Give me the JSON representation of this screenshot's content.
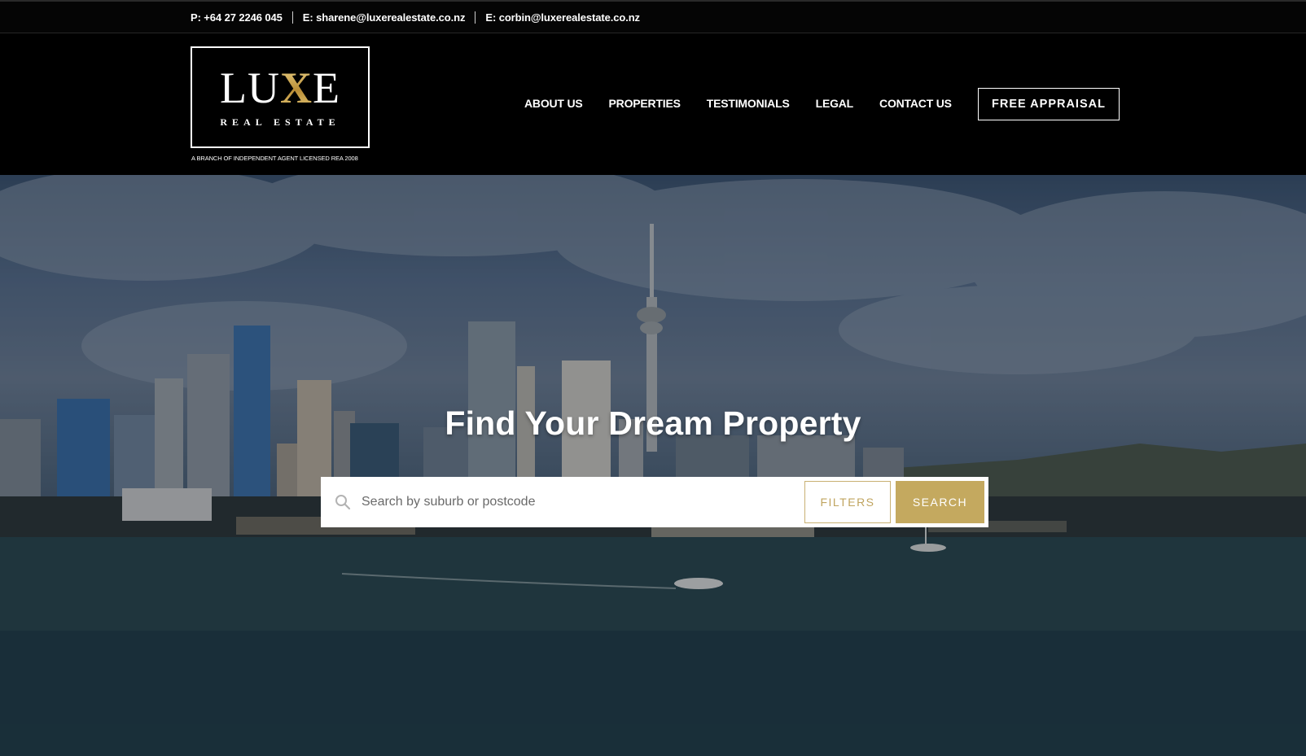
{
  "topbar": {
    "phone": "P: +64 27 2246 045",
    "email1": "E: sharene@luxerealestate.co.nz",
    "email2": "E: corbin@luxerealestate.co.nz"
  },
  "logo": {
    "word_start": "LU",
    "word_x": "X",
    "word_end": "E",
    "subtitle": "REAL ESTATE",
    "caption": "A BRANCH OF INDEPENDENT AGENT LICENSED REA 2008"
  },
  "nav": {
    "items": [
      {
        "label": "ABOUT US"
      },
      {
        "label": "PROPERTIES"
      },
      {
        "label": "TESTIMONIALS"
      },
      {
        "label": "LEGAL"
      },
      {
        "label": "CONTACT US"
      }
    ],
    "cta": "FREE APPRAISAL"
  },
  "hero": {
    "title": "Find Your Dream Property"
  },
  "search": {
    "placeholder": "Search by suburb or postcode",
    "value": "",
    "filters_label": "FILTERS",
    "search_label": "SEARCH"
  },
  "colors": {
    "accent_gold": "#c4a95f",
    "header_bg": "#000000"
  }
}
